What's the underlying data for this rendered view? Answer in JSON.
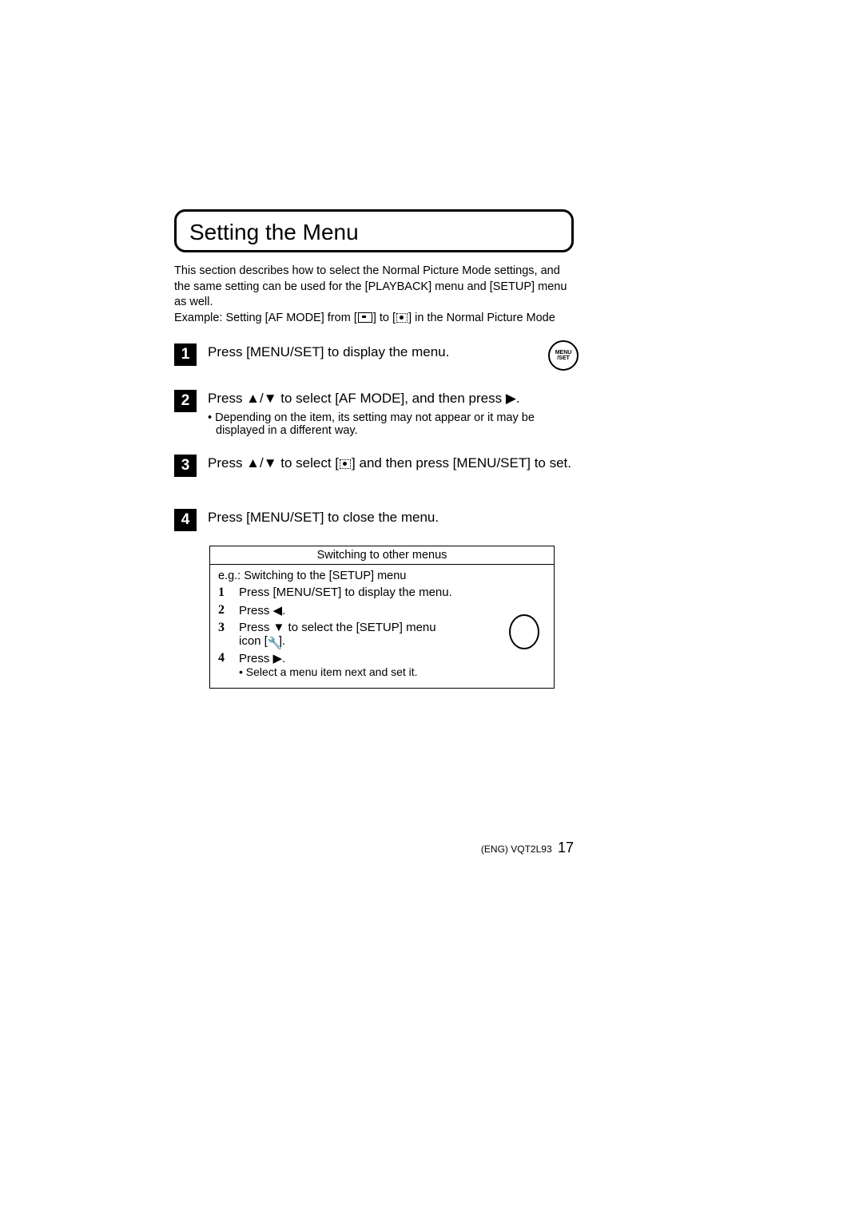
{
  "title": "Setting the Menu",
  "intro_line1": "This section describes how to select the Normal Picture Mode settings, and the same setting can be used for the [PLAYBACK] menu and [SETUP] menu as well.",
  "intro_line2_pre": "Example: Setting [AF MODE] from [",
  "intro_line2_mid": "] to [",
  "intro_line2_post": "] in the Normal Picture Mode",
  "menu_btn_top": "MENU",
  "menu_btn_bot": "/SET",
  "steps": [
    {
      "num": "1",
      "title": "Press [MENU/SET] to display the menu."
    },
    {
      "num": "2",
      "title": "Press ▲/▼ to select [AF MODE], and then press ▶.",
      "note": "Depending on the item, its setting may not appear or it may be displayed in a different way."
    },
    {
      "num": "3",
      "title_pre": "Press ▲/▼ to select [",
      "title_post": "] and then press [MENU/SET] to set."
    },
    {
      "num": "4",
      "title": "Press [MENU/SET] to close the menu."
    }
  ],
  "subbox": {
    "header": "Switching to other menus",
    "intro": "e.g.: Switching to the [SETUP] menu",
    "rows": [
      {
        "num": "1",
        "text": "Press [MENU/SET] to display the menu."
      },
      {
        "num": "2",
        "text": "Press ◀."
      },
      {
        "num": "3",
        "text_pre": "Press ▼ to select the [SETUP] menu icon [",
        "text_post": "]."
      },
      {
        "num": "4",
        "text": "Press ▶.",
        "bullet": "Select a menu item next and set it."
      }
    ]
  },
  "footer_code": "(ENG) VQT2L93",
  "footer_page": "17"
}
